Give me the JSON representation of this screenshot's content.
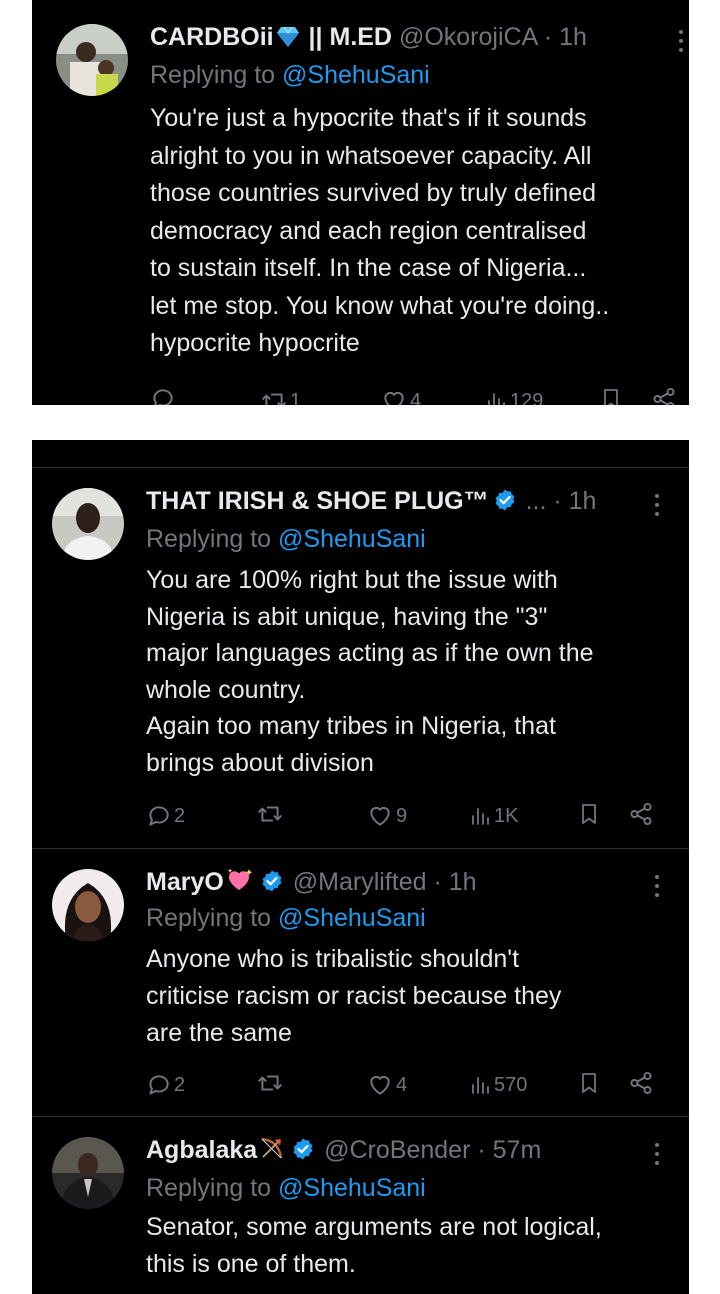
{
  "colors": {
    "background": "#000000",
    "text": "#e7e9ea",
    "muted": "#71767b",
    "link": "#1d9bf0",
    "divider": "#2f3336",
    "verified": "#1d9bf0"
  },
  "tweets": [
    {
      "name": "CARDBOii",
      "name_emoji": "gem-icon",
      "name_suffix": " || M.ED",
      "handle": "@OkorojiCA",
      "time": "· 1h",
      "replying_prefix": "Replying to ",
      "replying_handle": "@ShehuSani",
      "lines": [
        "You're just a hypocrite that's if it sounds",
        "alright to you in whatsoever capacity. All",
        "those countries survived by truly defined",
        "democracy and each region centralised",
        "to sustain itself. In the case of Nigeria...",
        "let me stop. You know what you're doing..",
        "hypocrite hypocrite"
      ],
      "retweets": "1",
      "likes": "4",
      "views": "129"
    },
    {
      "name": "THAT IRISH & SHOE PLUG™",
      "verified": true,
      "handle_ellipsis": "...",
      "time": "· 1h",
      "replying_prefix": "Replying to ",
      "replying_handle": "@ShehuSani",
      "lines": [
        "You are 100% right but the issue with",
        "Nigeria is abit unique, having the \"3\"",
        "major languages acting as if the own the",
        "whole country.",
        "Again too many tribes in Nigeria, that",
        "brings about division"
      ],
      "replies": "2",
      "likes": "9",
      "views": "1K"
    },
    {
      "name": "MaryO",
      "name_emoji": "sparkling-heart-icon",
      "verified": true,
      "handle": "@Marylifted",
      "time": "· 1h",
      "replying_prefix": "Replying to ",
      "replying_handle": "@ShehuSani",
      "lines": [
        "Anyone who is tribalistic shouldn't",
        "criticise racism or racist because they",
        "are the same"
      ],
      "replies": "2",
      "likes": "4",
      "views": "570"
    },
    {
      "name": "Agbalaka",
      "name_emoji": "bow-and-arrow-icon",
      "verified": true,
      "handle": "@CroBender",
      "time": "· 57m",
      "replying_prefix": "Replying to ",
      "replying_handle": "@ShehuSani",
      "lines": [
        "Senator, some arguments are not logical,",
        "this is one of them."
      ]
    }
  ]
}
